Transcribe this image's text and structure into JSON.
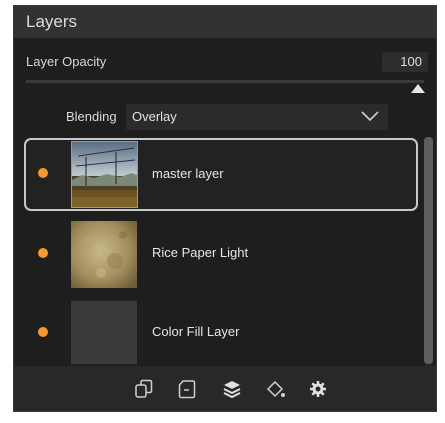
{
  "panel": {
    "title": "Layers"
  },
  "opacity": {
    "label": "Layer Opacity",
    "value": "100"
  },
  "blending": {
    "label": "Blending",
    "value": "Overlay"
  },
  "layers": [
    {
      "name": "master layer",
      "selected": true,
      "visible": true
    },
    {
      "name": "Rice Paper Light",
      "selected": false,
      "visible": true
    },
    {
      "name": "Color Fill Layer",
      "selected": false,
      "visible": true
    }
  ],
  "colors": {
    "accent_dot": "#f39a2e",
    "panel_bg": "#1e1e1e",
    "header_bg": "#323232",
    "fill_layer": "#3a3a3d"
  },
  "footer_icons": [
    "duplicate-layers-icon",
    "new-layer-icon",
    "layers-stack-icon",
    "paint-bucket-icon",
    "gear-icon"
  ]
}
